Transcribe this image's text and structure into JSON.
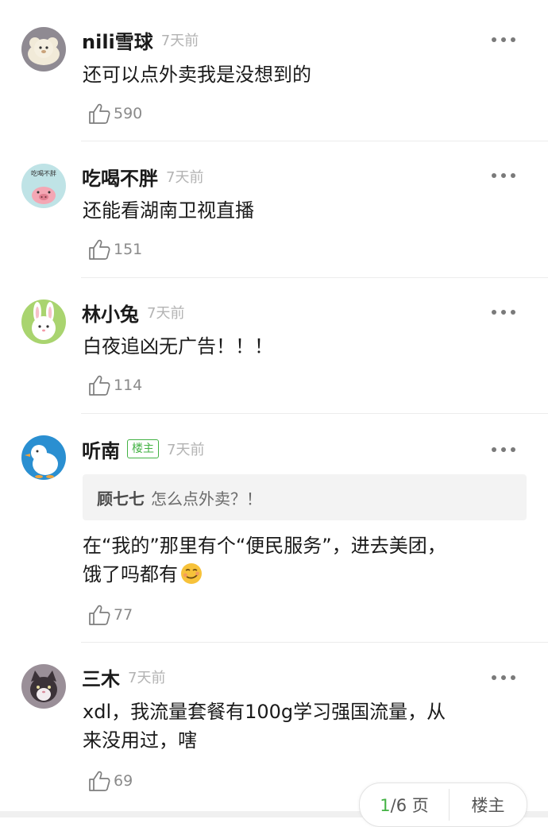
{
  "comments": [
    {
      "name": "nili雪球",
      "time": "7天前",
      "text": "还可以点外卖我是没想到的",
      "likes": "590"
    },
    {
      "name": "吃喝不胖",
      "time": "7天前",
      "text": "还能看湖南卫视直播",
      "likes": "151",
      "avatar_text": "吃喝不胖"
    },
    {
      "name": "林小兔",
      "time": "7天前",
      "text": "白夜追凶无广告！！！",
      "likes": "114"
    },
    {
      "name": "听南",
      "badge": "楼主",
      "time": "7天前",
      "quote": {
        "name": "顾七七",
        "text": "怎么点外卖？！"
      },
      "text": "在“我的”那里有个“便民服务”，进去美团，\n饿了吗都有",
      "likes": "77"
    },
    {
      "name": "三木",
      "time": "7天前",
      "text": "xdl，我流量套餐有100g学习强国流量，从\n来没用过，嗐",
      "likes": "69"
    }
  ],
  "pager": {
    "current": "1",
    "total_label": "/6 页",
    "owner_label": "楼主"
  },
  "icons": {
    "more": "more-dots-icon",
    "like": "thumb-up-icon",
    "emoji": "smirk-emoji"
  },
  "colors": {
    "accent": "#43b244",
    "time": "#b3b3b3",
    "quote_bg": "#f3f3f3"
  }
}
